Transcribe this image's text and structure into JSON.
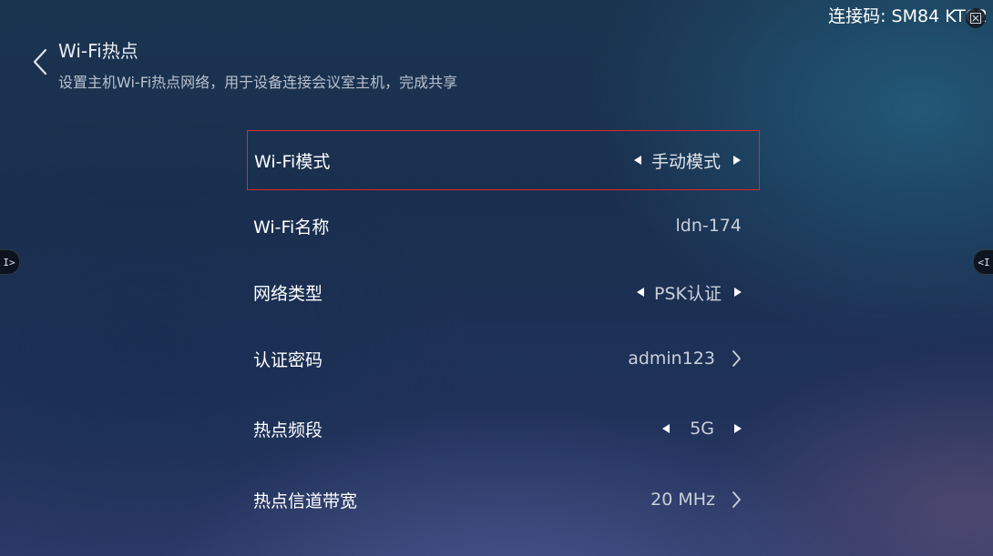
{
  "connection": {
    "code_text": "连接码: SM84 KT62"
  },
  "header": {
    "title": "Wi-Fi热点",
    "subtitle": "设置主机Wi-Fi热点网络，用于设备连接会议室主机，完成共享",
    "back_icon": "chevron-left-icon"
  },
  "side_handles": {
    "left_label": "I>",
    "right_label": "<I"
  },
  "settings": [
    {
      "label": "Wi-Fi模式",
      "value": "手动模式",
      "control": "arrows",
      "selected": true
    },
    {
      "label": "Wi-Fi名称",
      "value": "ldn-174",
      "control": "none",
      "selected": false
    },
    {
      "label": "网络类型",
      "value": "PSK认证",
      "control": "arrows",
      "selected": false
    },
    {
      "label": "认证密码",
      "value": "admin123",
      "control": "chevron",
      "selected": false
    },
    {
      "label": "热点频段",
      "value": "5G",
      "control": "arrows",
      "selected": false
    },
    {
      "label": "热点信道带宽",
      "value": "20 MHz",
      "control": "chevron",
      "selected": false
    }
  ],
  "colors": {
    "selection_border": "#e0262f",
    "background_top": "#1a3450",
    "background_bottom": "#2b3a66"
  }
}
